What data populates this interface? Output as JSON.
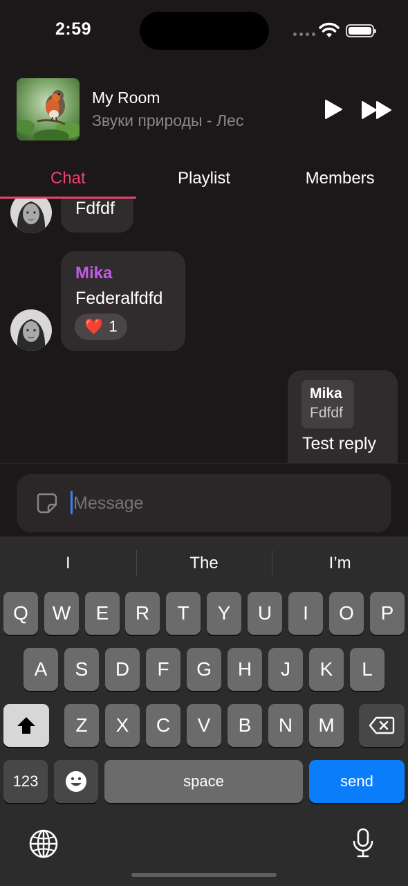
{
  "status_bar": {
    "time": "2:59"
  },
  "player": {
    "room_name": "My Room",
    "track_name": "Звуки природы - Лес"
  },
  "tabs": [
    {
      "label": "Chat",
      "active": true
    },
    {
      "label": "Playlist",
      "active": false
    },
    {
      "label": "Members",
      "active": false
    }
  ],
  "messages": [
    {
      "text": "Fdfdf"
    },
    {
      "sender": "Mika",
      "text": "Federalfdfd",
      "reaction": {
        "emoji": "❤️",
        "count": "1"
      }
    },
    {
      "outgoing": true,
      "reply_to": {
        "name": "Mika",
        "text": "Fdfdf"
      },
      "text": "Test reply"
    }
  ],
  "composer": {
    "placeholder": "Message"
  },
  "keyboard": {
    "suggestions": [
      "I",
      "The",
      "I’m"
    ],
    "row1": [
      "Q",
      "W",
      "E",
      "R",
      "T",
      "Y",
      "U",
      "I",
      "O",
      "P"
    ],
    "row2": [
      "A",
      "S",
      "D",
      "F",
      "G",
      "H",
      "J",
      "K",
      "L"
    ],
    "row3": [
      "Z",
      "X",
      "C",
      "V",
      "B",
      "N",
      "M"
    ],
    "numbers_label": "123",
    "space_label": "space",
    "send_label": "send"
  },
  "colors": {
    "accent": "#e9426a",
    "sender_name": "#c25ce6",
    "send_key": "#0a7dfa",
    "background": "#1c1819",
    "bubble": "#302b2c"
  }
}
